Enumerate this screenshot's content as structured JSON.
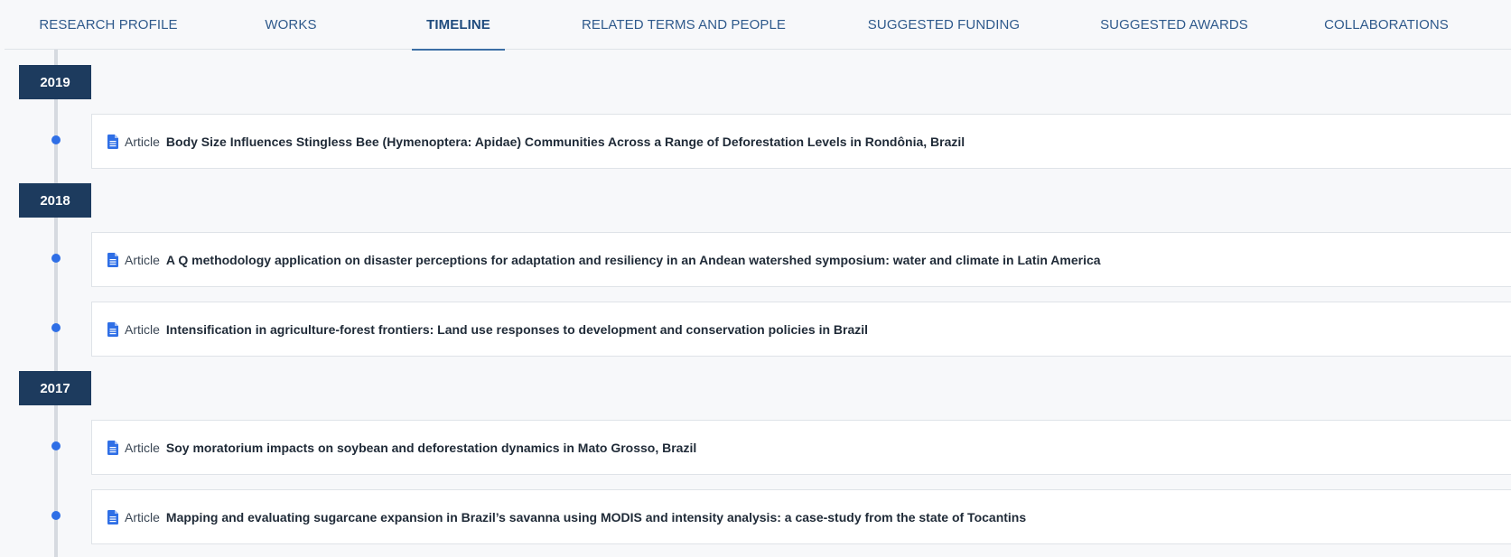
{
  "tabs": [
    {
      "label": "RESEARCH PROFILE",
      "active": false
    },
    {
      "label": "WORKS",
      "active": false
    },
    {
      "label": "TIMELINE",
      "active": true
    },
    {
      "label": "RELATED TERMS AND PEOPLE",
      "active": false
    },
    {
      "label": "SUGGESTED FUNDING",
      "active": false
    },
    {
      "label": "SUGGESTED AWARDS",
      "active": false
    },
    {
      "label": "COLLABORATIONS",
      "active": false
    }
  ],
  "timeline": [
    {
      "year": "2019",
      "items": [
        {
          "type": "Article",
          "icon": "document-icon",
          "title": "Body Size Influences Stingless Bee (Hymenoptera: Apidae) Communities Across a Range of Deforestation Levels in Rondônia, Brazil"
        }
      ]
    },
    {
      "year": "2018",
      "items": [
        {
          "type": "Article",
          "icon": "document-icon",
          "title": "A Q methodology application on disaster perceptions for adaptation and resiliency in an Andean watershed symposium: water and climate in Latin America"
        },
        {
          "type": "Article",
          "icon": "document-icon",
          "title": "Intensification in agriculture-forest frontiers: Land use responses to development and conservation policies in Brazil"
        }
      ]
    },
    {
      "year": "2017",
      "items": [
        {
          "type": "Article",
          "icon": "document-icon",
          "title": "Soy moratorium impacts on soybean and deforestation dynamics in Mato Grosso, Brazil"
        },
        {
          "type": "Article",
          "icon": "document-icon",
          "title": "Mapping and evaluating sugarcane expansion in Brazil’s savanna using MODIS and intensity analysis: a case-study from the state of Tocantins"
        }
      ]
    }
  ],
  "colors": {
    "year_badge": "#1d3b5e",
    "timeline_dot": "#2f6fe6",
    "tab_text": "#2f5a8c",
    "active_tab_underline": "#3c6ea5",
    "doc_icon": "#2f6fe6"
  }
}
